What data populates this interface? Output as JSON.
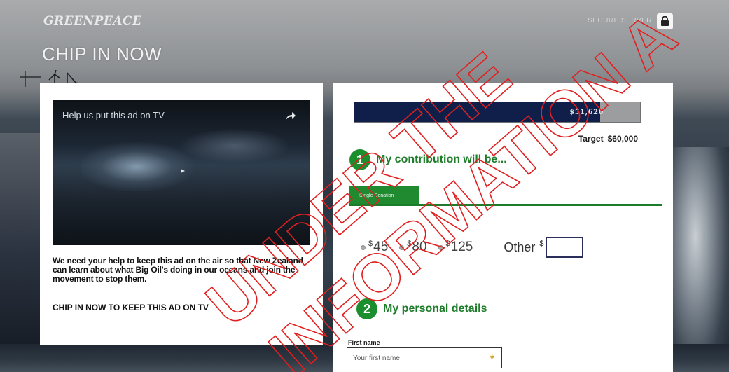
{
  "brand": {
    "logo_text": "GREENPEACE"
  },
  "header": {
    "title": "CHIP IN NOW",
    "secure_label": "SECURE SERVER",
    "lock_icon": "lock-icon"
  },
  "video": {
    "title": "Help us put this ad on TV",
    "share_icon": "share-icon",
    "play_icon": "play-icon"
  },
  "campaign": {
    "description": "We need your help to keep this ad on the air so that New Zealand can learn about what Big Oil's doing in our oceans and join the movement to stop them.",
    "cta": "CHIP IN NOW TO KEEP THIS AD ON TV"
  },
  "progress": {
    "raised": "$51,620",
    "target_label": "Target",
    "target_value": "$60,000",
    "fraction": 0.86
  },
  "step1": {
    "number": "1",
    "title": "My contribution will be..."
  },
  "donation_tab": {
    "label": "Single Donation"
  },
  "amounts": [
    {
      "symbol": "$",
      "value": "45"
    },
    {
      "symbol": "$",
      "value": "80"
    },
    {
      "symbol": "$",
      "value": "125"
    }
  ],
  "other": {
    "label": "Other",
    "symbol": "$",
    "value": ""
  },
  "step2": {
    "number": "2",
    "title": "My personal details"
  },
  "first_name": {
    "label": "First name",
    "placeholder": "Your first name",
    "required_mark": "*"
  },
  "watermark": {
    "line1": "UNDER THE",
    "line2": "INFORMATION A",
    "line3": "UNDER THE",
    "color": "#e02020"
  },
  "colors": {
    "green": "#1b8e2d",
    "navy": "#0f1f4a"
  }
}
